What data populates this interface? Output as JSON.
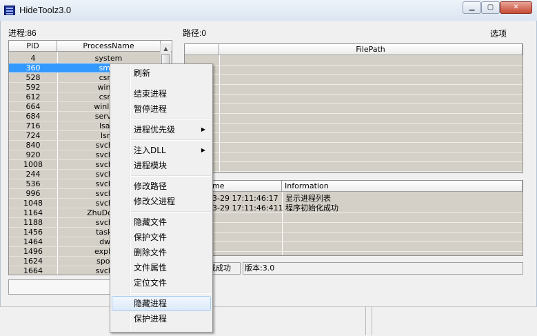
{
  "window": {
    "title": "HideToolz3.0",
    "controls": {
      "minimize": "▁",
      "maximize": "▢",
      "close": "✕"
    }
  },
  "left": {
    "process_count_label": "进程:86",
    "columns": [
      "PID",
      "ProcessName"
    ],
    "rows": [
      {
        "pid": "4",
        "name": "system"
      },
      {
        "pid": "360",
        "name": "smss"
      },
      {
        "pid": "528",
        "name": "csrss"
      },
      {
        "pid": "592",
        "name": "winini"
      },
      {
        "pid": "612",
        "name": "csrss"
      },
      {
        "pid": "664",
        "name": "winlogo"
      },
      {
        "pid": "684",
        "name": "service"
      },
      {
        "pid": "716",
        "name": "lsass"
      },
      {
        "pid": "724",
        "name": "lsm."
      },
      {
        "pid": "840",
        "name": "svchos"
      },
      {
        "pid": "920",
        "name": "svchos"
      },
      {
        "pid": "1008",
        "name": "svchos"
      },
      {
        "pid": "244",
        "name": "svchos"
      },
      {
        "pid": "536",
        "name": "svchos"
      },
      {
        "pid": "996",
        "name": "svchos"
      },
      {
        "pid": "1048",
        "name": "svchos"
      },
      {
        "pid": "1164",
        "name": "ZhuDongFa"
      },
      {
        "pid": "1188",
        "name": "svchos"
      },
      {
        "pid": "1456",
        "name": "taskho"
      },
      {
        "pid": "1464",
        "name": "dwm"
      },
      {
        "pid": "1496",
        "name": "explore"
      },
      {
        "pid": "1624",
        "name": "spools"
      },
      {
        "pid": "1664",
        "name": "svchos"
      }
    ],
    "selected_index": 1
  },
  "right": {
    "path_label": "路径:0",
    "options_label": "选项",
    "filepath_header": "FilePath",
    "log_columns": [
      "me",
      "Information"
    ],
    "log_rows": [
      {
        "time": "3-29 17:11:46:17",
        "info": "显示进程列表"
      },
      {
        "time": "3-29 17:11:46:411",
        "info": "程序初始化成功"
      }
    ],
    "status_left": "载成功",
    "status_version": "版本:3.0"
  },
  "context_menu": {
    "items": [
      {
        "label": "刷新",
        "submenu": false
      },
      {
        "sep": true
      },
      {
        "label": "结束进程",
        "submenu": false
      },
      {
        "label": "暂停进程",
        "submenu": false
      },
      {
        "sep": true
      },
      {
        "label": "进程优先级",
        "submenu": true
      },
      {
        "sep": true
      },
      {
        "label": "注入DLL",
        "submenu": true
      },
      {
        "label": "进程模块",
        "submenu": false
      },
      {
        "sep": true
      },
      {
        "label": "修改路径",
        "submenu": false
      },
      {
        "label": "修改父进程",
        "submenu": false
      },
      {
        "sep": true
      },
      {
        "label": "隐藏文件",
        "submenu": false
      },
      {
        "label": "保护文件",
        "submenu": false
      },
      {
        "label": "删除文件",
        "submenu": false
      },
      {
        "label": "文件属性",
        "submenu": false
      },
      {
        "label": "定位文件",
        "submenu": false
      },
      {
        "sep": true
      },
      {
        "label": "隐藏进程",
        "submenu": false,
        "highlighted": true
      },
      {
        "label": "保护进程",
        "submenu": false
      }
    ],
    "submenu_arrow": "▶"
  }
}
